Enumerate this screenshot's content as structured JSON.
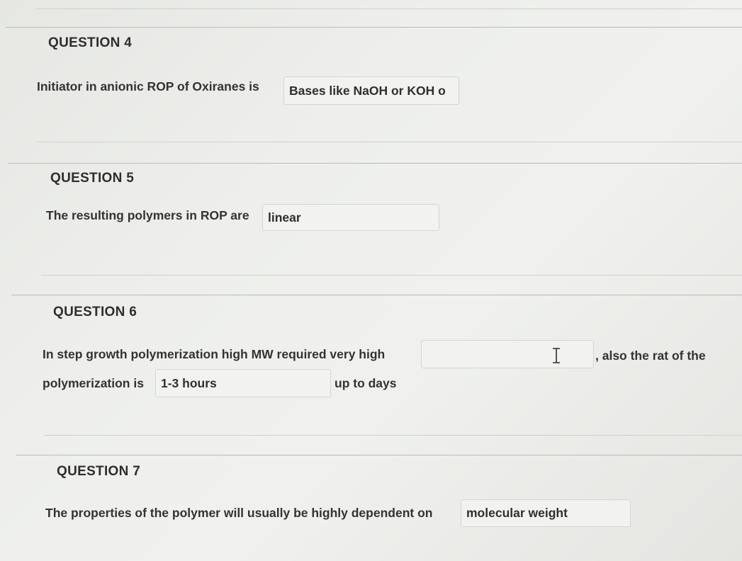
{
  "q4": {
    "title": "QUESTION 4",
    "prompt": "Initiator in anionic ROP of Oxiranes is",
    "answer": "Bases like NaOH or KOH o"
  },
  "q5": {
    "title": "QUESTION 5",
    "prompt": "The resulting polymers in ROP are",
    "answer": "linear"
  },
  "q6": {
    "title": "QUESTION 6",
    "prompt_part1": "In step growth polymerization high MW required  very high",
    "answer1": "",
    "prompt_part2": ", also the rat of the",
    "prompt_part3": "polymerization is",
    "answer2": "1-3 hours",
    "prompt_part4": "up to days"
  },
  "q7": {
    "title": "QUESTION 7",
    "prompt": "The properties of the polymer will usually be highly dependent on",
    "answer": "molecular weight"
  }
}
